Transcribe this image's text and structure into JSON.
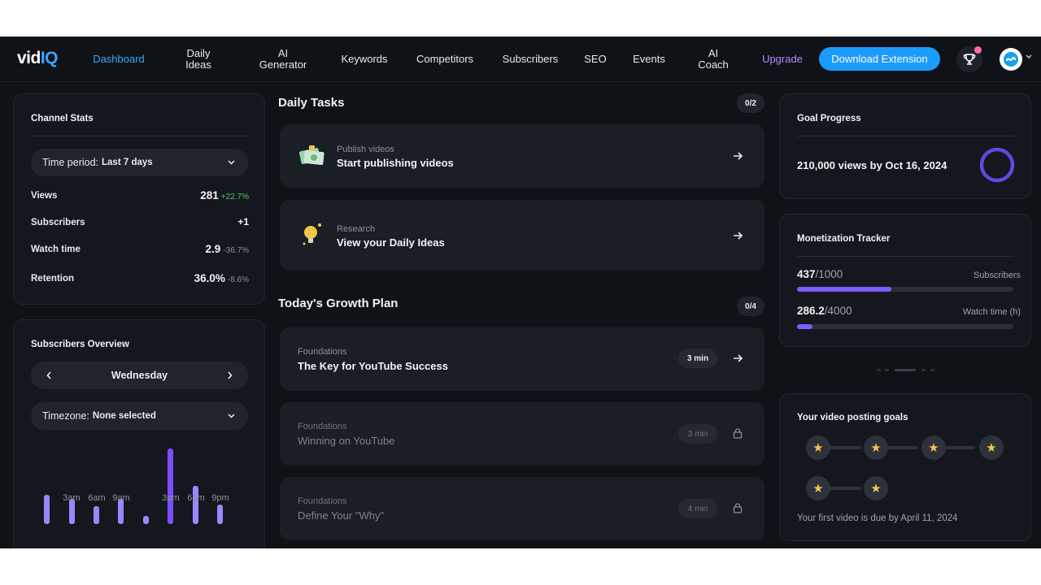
{
  "nav": {
    "logo_a": "vid",
    "logo_b": "IQ",
    "items": [
      {
        "label": "Dashboard"
      },
      {
        "label": "Daily\nIdeas"
      },
      {
        "label": "AI\nGenerator"
      },
      {
        "label": "Keywords"
      },
      {
        "label": "Competitors"
      },
      {
        "label": "Subscribers"
      },
      {
        "label": "SEO"
      },
      {
        "label": "Events"
      },
      {
        "label": "AI\nCoach"
      },
      {
        "label": "Upgrade"
      }
    ],
    "download_label": "Download Extension"
  },
  "channel_stats": {
    "title": "Channel Stats",
    "period_label": "Time period:",
    "period_value": "Last 7 days",
    "rows": [
      {
        "label": "Views",
        "value": "281",
        "change": "+22.7%",
        "dir": "up"
      },
      {
        "label": "Subscribers",
        "value": "+1",
        "change": "",
        "dir": "none"
      },
      {
        "label": "Watch time",
        "value": "2.9",
        "change": "-36.7%",
        "dir": "down"
      },
      {
        "label": "Retention",
        "value": "36.0%",
        "change": "-8.6%",
        "dir": "down"
      }
    ]
  },
  "subs_overview": {
    "title": "Subscribers Overview",
    "day": "Wednesday",
    "tz_label": "Timezone:",
    "tz_value": "None selected",
    "ticks": [
      "3am",
      "6am",
      "9am",
      "3pm",
      "6pm",
      "9pm"
    ],
    "bars": [
      0.39,
      0.33,
      0.24,
      0.33,
      0.11,
      1.0,
      0.51,
      0.26
    ]
  },
  "daily_tasks": {
    "title": "Daily Tasks",
    "count": "0/2",
    "items": [
      {
        "kicker": "Publish videos",
        "title": "Start publishing videos"
      },
      {
        "kicker": "Research",
        "title": "View your Daily Ideas"
      }
    ]
  },
  "growth_plan": {
    "title": "Today's Growth Plan",
    "count": "0/4",
    "items": [
      {
        "kicker": "Foundations",
        "title": "The Key for YouTube Success",
        "time": "3 min",
        "locked": false
      },
      {
        "kicker": "Foundations",
        "title": "Winning on YouTube",
        "time": "3 min",
        "locked": true
      },
      {
        "kicker": "Foundations",
        "title": "Define Your \"Why\"",
        "time": "4 min",
        "locked": true
      }
    ]
  },
  "goal_progress": {
    "title": "Goal Progress",
    "goal_text": "210,000 views by Oct 16, 2024"
  },
  "monetization": {
    "title": "Monetization Tracker",
    "rows": [
      {
        "current": "437",
        "target": "/1000",
        "label": "Subscribers",
        "fraction": 0.437
      },
      {
        "current": "286.2",
        "target": "/4000",
        "label": "Watch time (h)",
        "fraction": 0.0716
      }
    ]
  },
  "posting_goals": {
    "title": "Your video posting goals",
    "footer": "Your first video is due by April 11, 2024",
    "stars": 6
  },
  "colors": {
    "accent": "#3ea6ff",
    "purple": "#7b5cff",
    "positive": "#3ecf6a",
    "star": "#f3c64a"
  }
}
